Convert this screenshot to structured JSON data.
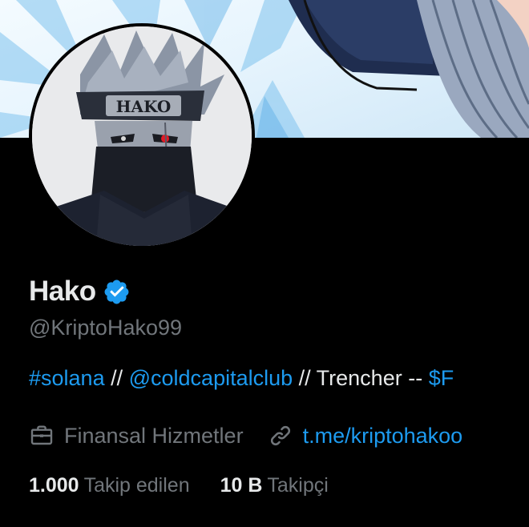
{
  "profile": {
    "name": "Hako",
    "verified": true,
    "handle": "@KriptoHako99",
    "avatar_text": "HAKO"
  },
  "bio": {
    "hashtag": "#solana",
    "sep1": " // ",
    "mention": "@coldcapitalclub",
    "sep2": " // Trencher -- ",
    "cashtag": "$F"
  },
  "meta": {
    "category_icon": "briefcase-icon",
    "category": "Finansal Hizmetler",
    "link_icon": "link-icon",
    "link": "t.me/kriptohakoo"
  },
  "stats": {
    "following_count": "1.000",
    "following_label": "Takip edilen",
    "followers_count": "10 B",
    "followers_label": "Takipçi"
  },
  "colors": {
    "accent": "#1d9bf0",
    "muted": "#71767b",
    "text": "#e7e9ea",
    "background": "#000000"
  }
}
